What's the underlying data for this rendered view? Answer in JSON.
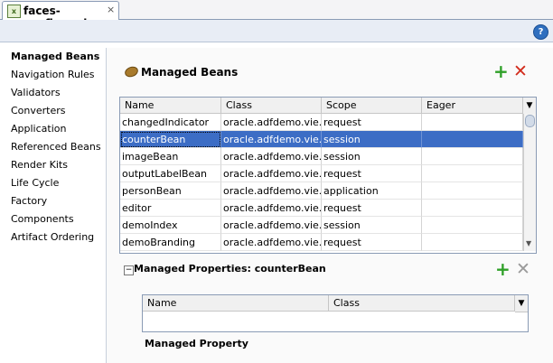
{
  "editor_tab": {
    "title": "faces-config.xml",
    "close": "×",
    "icon": "xml-file-icon"
  },
  "help": {
    "label": "?",
    "icon": "help-icon"
  },
  "nav": {
    "items": [
      {
        "label": "Managed Beans",
        "selected": true
      },
      {
        "label": "Navigation Rules"
      },
      {
        "label": "Validators"
      },
      {
        "label": "Converters"
      },
      {
        "label": "Application"
      },
      {
        "label": "Referenced Beans"
      },
      {
        "label": "Render Kits"
      },
      {
        "label": "Life Cycle"
      },
      {
        "label": "Factory"
      },
      {
        "label": "Components"
      },
      {
        "label": "Artifact Ordering"
      }
    ]
  },
  "managed_beans": {
    "title": "Managed Beans",
    "icon": "bean-icon",
    "add": "+",
    "remove": "✕",
    "columns": [
      "Name",
      "Class",
      "Scope",
      "Eager"
    ],
    "menu": "▼",
    "rows": [
      {
        "name": "changedIndicator",
        "class": "oracle.adfdemo.vie...",
        "scope": "request",
        "eager": ""
      },
      {
        "name": "counterBean",
        "class": "oracle.adfdemo.vie...",
        "scope": "session",
        "eager": "",
        "selected": true
      },
      {
        "name": "imageBean",
        "class": "oracle.adfdemo.vie...",
        "scope": "session",
        "eager": ""
      },
      {
        "name": "outputLabelBean",
        "class": "oracle.adfdemo.vie...",
        "scope": "request",
        "eager": ""
      },
      {
        "name": "personBean",
        "class": "oracle.adfdemo.vie...",
        "scope": "application",
        "eager": ""
      },
      {
        "name": "editor",
        "class": "oracle.adfdemo.vie...",
        "scope": "request",
        "eager": ""
      },
      {
        "name": "demoIndex",
        "class": "oracle.adfdemo.vie...",
        "scope": "session",
        "eager": ""
      },
      {
        "name": "demoBranding",
        "class": "oracle.adfdemo.vie...",
        "scope": "request",
        "eager": ""
      }
    ]
  },
  "managed_properties": {
    "collapse": "−",
    "title": "Managed Properties: counterBean",
    "add": "+",
    "remove": "✕",
    "columns": [
      "Name",
      "Class"
    ],
    "menu": "▼",
    "section_label": "Managed Property"
  },
  "colors": {
    "selection": "#3c6dc5",
    "add": "#2fa028",
    "remove": "#d22c1c"
  }
}
